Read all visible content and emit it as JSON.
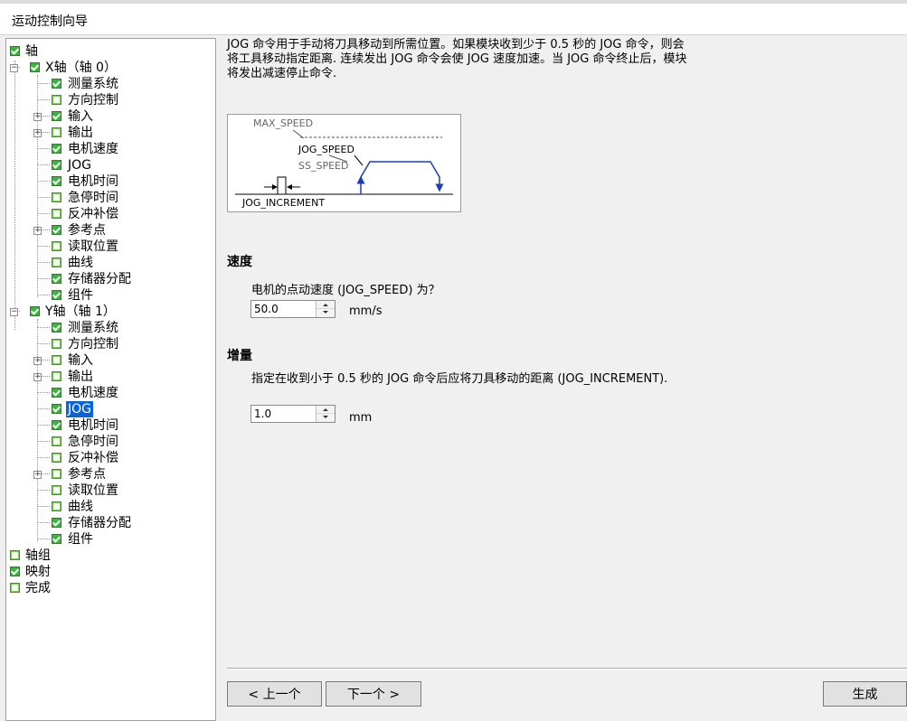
{
  "window": {
    "title": "运动控制向导"
  },
  "tree": {
    "root_axis": "轴",
    "x_axis": "X轴（轴 0）",
    "y_axis": "Y轴（轴 1）",
    "x_children": [
      "测量系统",
      "方向控制",
      "输入",
      "输出",
      "电机速度",
      "JOG",
      "电机时间",
      "急停时间",
      "反冲补偿",
      "参考点",
      "读取位置",
      "曲线",
      "存储器分配",
      "组件"
    ],
    "y_children": [
      "测量系统",
      "方向控制",
      "输入",
      "输出",
      "电机速度",
      "JOG",
      "电机时间",
      "急停时间",
      "反冲补偿",
      "参考点",
      "读取位置",
      "曲线",
      "存储器分配",
      "组件"
    ],
    "axis_group": "轴组",
    "mapping": "映射",
    "finish": "完成",
    "selected": "JOG"
  },
  "description": {
    "line1": "JOG 命令用于手动将刀具移动到所需位置。如果模块收到少于 0.5 秒的 JOG 命令，则会",
    "line2": "将工具移动指定距离. 连续发出 JOG 命令会使 JOG 速度加速。当 JOG 命令终止后，模块",
    "line3": "将发出减速停止命令."
  },
  "diagram": {
    "max_speed": "MAX_SPEED",
    "jog_speed": "JOG_SPEED",
    "ss_speed": "SS_SPEED",
    "jog_increment": "JOG_INCREMENT"
  },
  "speed": {
    "title": "速度",
    "label": "电机的点动速度 (JOG_SPEED) 为？",
    "value": "50.0",
    "unit": "mm/s"
  },
  "increment": {
    "title": "增量",
    "label": "指定在收到小于 0.5 秒的 JOG 命令后应将刀具移动的距离 (JOG_INCREMENT).",
    "value": "1.0",
    "unit": "mm"
  },
  "buttons": {
    "prev": "< 上一个",
    "next": "下一个 >",
    "generate": "生成"
  }
}
